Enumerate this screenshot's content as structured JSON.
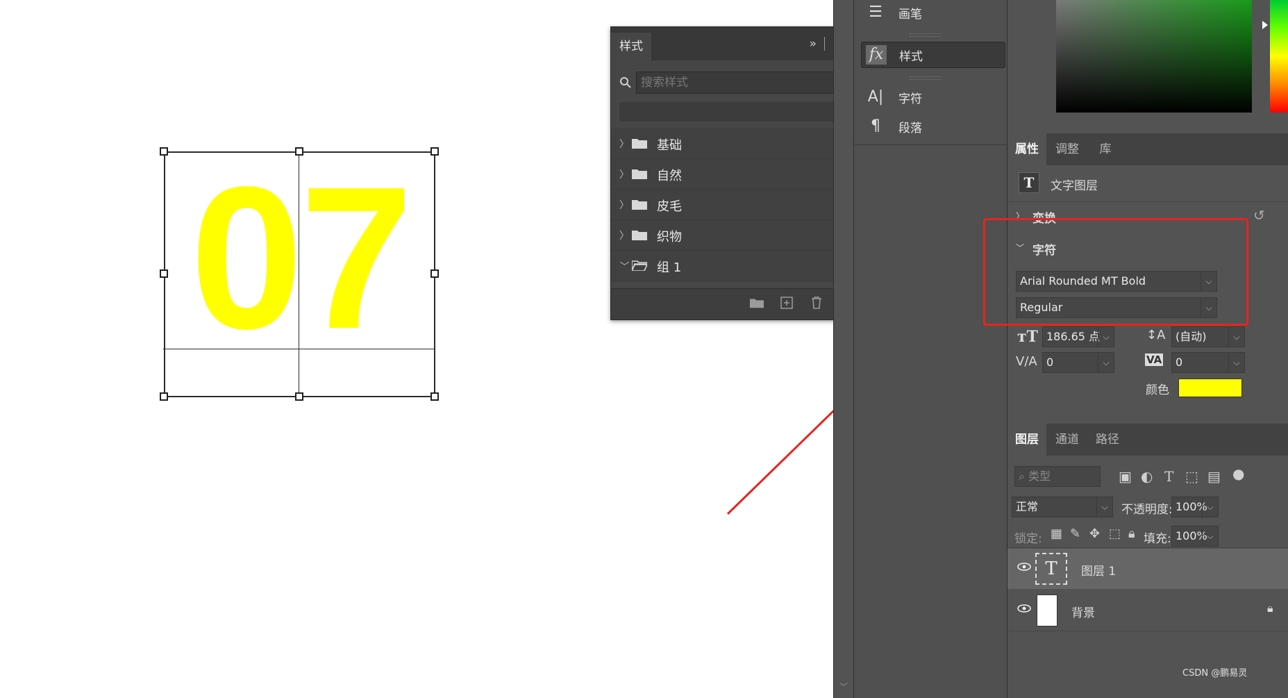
{
  "canvas": {
    "text": "07",
    "text_color": "#ffff00"
  },
  "styles_panel": {
    "tab": "样式",
    "search_placeholder": "搜索样式",
    "items": [
      {
        "label": "基础",
        "expanded": false
      },
      {
        "label": "自然",
        "expanded": false
      },
      {
        "label": "皮毛",
        "expanded": false
      },
      {
        "label": "织物",
        "expanded": false
      },
      {
        "label": "组 1",
        "expanded": true
      }
    ]
  },
  "mid_dock": {
    "items": [
      {
        "label": "画笔",
        "icon": "brush-settings-icon"
      },
      {
        "label": "样式",
        "icon": "fx-icon",
        "active": true
      },
      {
        "label": "字符",
        "icon": "character-icon"
      },
      {
        "label": "段落",
        "icon": "paragraph-icon"
      }
    ]
  },
  "properties": {
    "tabs": [
      "属性",
      "调整",
      "库"
    ],
    "layer_type": "文字图层",
    "transform_label": "变换",
    "character_label": "字符",
    "font_family": "Arial Rounded MT Bold",
    "font_style": "Regular",
    "font_size": "186.65 点",
    "leading": "(自动)",
    "kerning": "0",
    "tracking": "0",
    "color_label": "颜色",
    "color_value": "#ffff00"
  },
  "layers": {
    "tabs": [
      "图层",
      "通道",
      "路径"
    ],
    "filter_placeholder": "类型",
    "blend_mode": "正常",
    "opacity_label": "不透明度:",
    "opacity": "100%",
    "lock_label": "锁定:",
    "fill_label": "填充:",
    "fill": "100%",
    "items": [
      {
        "name": "图层 1",
        "type": "text",
        "selected": true
      },
      {
        "name": "背景",
        "type": "background",
        "locked": true
      }
    ]
  },
  "watermark": "CSDN @鹏易灵",
  "highlight_color": "#e8231f"
}
